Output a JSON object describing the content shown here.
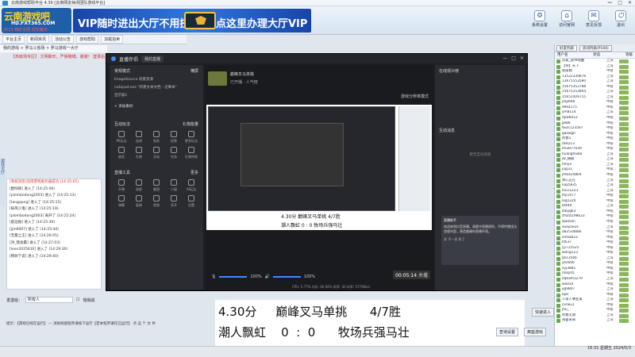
{
  "window": {
    "title": "云南游戏帮助平台 4.39 [云南网友休闲团队游戏平台]",
    "controls": [
      "—",
      "□",
      "✕"
    ]
  },
  "banner": {
    "logo_main": "云南游戏吧",
    "logo_url": "HD.FXT365.COM",
    "logo_year": "2013 精彩无限 欢乐每天",
    "ad_left": "VIP随时进出大厅不用挤",
    "ad_right": "点这里办理大厅VIP",
    "top_icons": [
      {
        "icon": "gear-icon",
        "label": "系统设置"
      },
      {
        "icon": "home-icon",
        "label": "访问官网"
      },
      {
        "icon": "share-icon",
        "label": "意见反馈"
      },
      {
        "icon": "power-icon",
        "label": "退出"
      }
    ]
  },
  "toolbar": {
    "items": [
      "平台主页",
      "新闻资讯",
      "活动公告",
      "游戏帮助",
      "加载拍卖"
    ]
  },
  "breadcrumbs": "我的游戏 > 罗马斗兽场 > 罗马游戏一大厅",
  "room_title": "【高级场专区】 文明聊天，严禁赌博，谢谢！ 登录后请到游戏大厅...",
  "side_label": "游戏大厅",
  "chat": {
    "header": "[系统消息]连接游戏服务器成功 (14:25:05)",
    "lines": [
      "[欧阳锋] 进入了 (14:25:06)",
      "[plombodong2003] 进入了 (14:25:13)",
      "[tangqang] 进入了 (14:25:15)",
      "[纵风小鬼] 进入了 (14:25:19)",
      "[plombodong2003] 离开了 (14:25:24)",
      "[敲边鼓] 进入了 (14:25:30)",
      "[jjm0007] 进入了 (14:25:44)",
      "[无冕之王] 进入了 (14:26:05)",
      "[洪_我会赢] 进入了 (14:27:03)",
      "[leon2025610] 进入了 (14:29:30)",
      "[柳树下说] 进入了 (14:29:40)"
    ]
  },
  "input": {
    "label": "发送给：",
    "target": "所有人",
    "checkbox": "悄悄说"
  },
  "bottom_note": "提示：【游戏已经在运行】 — 消除残留程序请按下运行【若本程序请在已运行】 点 这 个 文 件",
  "obs": {
    "title": "直播伴侣",
    "tabs": [
      "我的直播"
    ],
    "left": {
      "section1": "常规模式",
      "section1_right": "横屏",
      "scene_items": [
        "ImageSource 场景资源",
        "notepad.exe \"新建文本文档 - 记事本\"",
        "显示器1"
      ],
      "add_material": "+ 添加素材",
      "section2": "互动玩法",
      "section2_right": "礼物能量",
      "tools1": [
        "PK玩法",
        "连线",
        "贴纸",
        "投票",
        "更多玩法",
        "抽奖",
        "礼物",
        "活动",
        "任务",
        "礼物特效"
      ],
      "section3": "直播工具",
      "section3_right": "更多",
      "tools2": [
        "开播",
        "录屏",
        "截图",
        "小窗",
        "AI玩法",
        "弹幕",
        "复制",
        "视频",
        "多开",
        "设置"
      ]
    },
    "stream": {
      "name": "巅峰叉马单挑",
      "sub": "已开播",
      "audience": "人气榜",
      "toggle": "游戏分辨率模式"
    },
    "score_line1": "4.30分    巅峰叉马单挑    4/7胜",
    "score_line2": "潮人飘虹   0  :  0    牧场兵强马壮",
    "volume1": "100%",
    "volume2": "100%",
    "timer": "00:05:14",
    "timer_suffix": "关播",
    "statusline": "CPU: 5.77%   内存: 66.66%   帧率: 30   码率: 5776Kb/s",
    "right": {
      "heading": "在线观众榜",
      "popup_title": "直播助手",
      "popup_text": "欢迎来到抖音直播。请遵守直播规则，不得传播违法违规内容，营造健康的直播环境。",
      "popup_footer": "关 不一关 知了",
      "section2": "互动消息",
      "section2_sub": "暂无互动消息"
    }
  },
  "caption": {
    "line1": "4.30分     巅峰叉马单挑      4/7胜",
    "line2": "潮人飘虹    0  :  0      牧场兵强马壮"
  },
  "bottom_buttons": {
    "enter": "快速进入",
    "setting": "查询设置",
    "leave": "离座游戏"
  },
  "right_panel": {
    "tabs": [
      "好友列表",
      "房间列表(P100)"
    ],
    "columns": [
      "用户名",
      "状态",
      "等级"
    ],
    "users": [
      {
        "name": "苏家_说书唱曲",
        "status": "上海"
      },
      {
        "name": "【导】天下",
        "status": "上海"
      },
      {
        "name": "陈丽刚",
        "status": "中级"
      },
      {
        "name": "13522339876",
        "status": "上海"
      },
      {
        "name": "13675553580",
        "status": "上海"
      },
      {
        "name": "15675353788",
        "status": "中级"
      },
      {
        "name": "15675353804",
        "status": "上海"
      },
      {
        "name": "15651409755",
        "status": "上海"
      },
      {
        "name": "jmp666",
        "status": "中级"
      },
      {
        "name": "99k4175",
        "status": "中级"
      },
      {
        "name": "ym8114",
        "status": "上海"
      },
      {
        "name": "dyw8412",
        "status": "中级"
      },
      {
        "name": "jj888",
        "status": "中级"
      },
      {
        "name": "fw2c123567",
        "status": "中级"
      },
      {
        "name": "gaowgh",
        "status": "中级"
      },
      {
        "name": "阿春1",
        "status": "中级"
      },
      {
        "name": "ds8213",
        "status": "中级"
      },
      {
        "name": "lm2B77039",
        "status": "中级"
      },
      {
        "name": "huanghaibo",
        "status": "上海"
      },
      {
        "name": "jw_楠楠",
        "status": "上海"
      },
      {
        "name": "hmyn",
        "status": "上海"
      },
      {
        "name": "jujlju1",
        "status": "中级"
      },
      {
        "name": "jm6424804",
        "status": "中级"
      },
      {
        "name": "关心正在",
        "status": "上海"
      },
      {
        "name": "luqi5835",
        "status": "上海"
      },
      {
        "name": "lxu11223",
        "status": "上海"
      },
      {
        "name": "lhy1977",
        "status": "中级"
      },
      {
        "name": "leg1220",
        "status": "中级"
      },
      {
        "name": "kt44d",
        "status": "上海"
      },
      {
        "name": "lbbyg63",
        "status": "中级"
      },
      {
        "name": "zhsfzi198623",
        "status": "中级"
      },
      {
        "name": "qiaosan",
        "status": "中级"
      },
      {
        "name": "xuejiaxue",
        "status": "上海"
      },
      {
        "name": "ab2534886",
        "status": "中级"
      },
      {
        "name": "xlnkab23",
        "status": "中级"
      },
      {
        "name": "kfk37",
        "status": "中级"
      },
      {
        "name": "yy725525",
        "status": "中级"
      },
      {
        "name": "wang123",
        "status": "中级"
      },
      {
        "name": "ljb13566",
        "status": "上海"
      },
      {
        "name": "yhs666",
        "status": "中级"
      },
      {
        "name": "xyj3881",
        "status": "中级"
      },
      {
        "name": "nhkjl05",
        "status": "中级"
      },
      {
        "name": "eq6am1279",
        "status": "上海"
      },
      {
        "name": "wad10",
        "status": "中级"
      },
      {
        "name": "yg9807",
        "status": "上海"
      },
      {
        "name": "lqss",
        "status": "中级"
      },
      {
        "name": "人家人事业家",
        "status": "上海"
      },
      {
        "name": "cxrwu1",
        "status": "中级"
      },
      {
        "name": "jhu_",
        "status": "中级"
      },
      {
        "name": "阿春无限",
        "status": "上海"
      },
      {
        "name": "海盗来来",
        "status": "上海"
      }
    ]
  },
  "clock": {
    "time": "16:31",
    "day": "星期五",
    "date": "2024/5/3"
  }
}
